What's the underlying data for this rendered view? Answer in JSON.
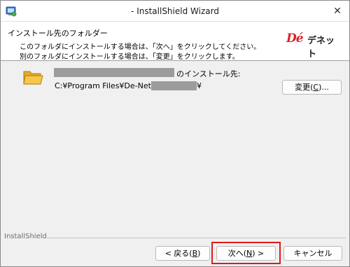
{
  "window": {
    "title": "- InstallShield Wizard",
    "close_glyph": "✕"
  },
  "header": {
    "title": "インストール先のフォルダー",
    "desc_line1": "このフォルダにインストールする場合は、「次へ」をクリックしてください。",
    "desc_line2": "別のフォルダにインストールする場合は、「変更」をクリックします。",
    "logo_mark": "Dé",
    "logo_text": "デネット"
  },
  "body": {
    "install_to_label": "のインストール先:",
    "path_prefix": "C:¥Program Files¥De-Net¥",
    "path_suffix": "¥",
    "change_button": {
      "text": "変更(",
      "key": "C",
      "suffix": ")..."
    }
  },
  "footer": {
    "brand": "InstallShield",
    "back_button": {
      "text": "< 戻る(",
      "key": "B",
      "suffix": ")"
    },
    "next_button": {
      "text": "次へ(",
      "key": "N",
      "suffix": ") >"
    },
    "cancel_button": "キャンセル"
  },
  "colors": {
    "highlight": "#e01a1a",
    "logo_red": "#d9232a",
    "folder_yellow": "#f5c74a"
  },
  "icons": {
    "app": "installer-app-icon",
    "folder": "folder-icon",
    "close": "close-icon"
  }
}
